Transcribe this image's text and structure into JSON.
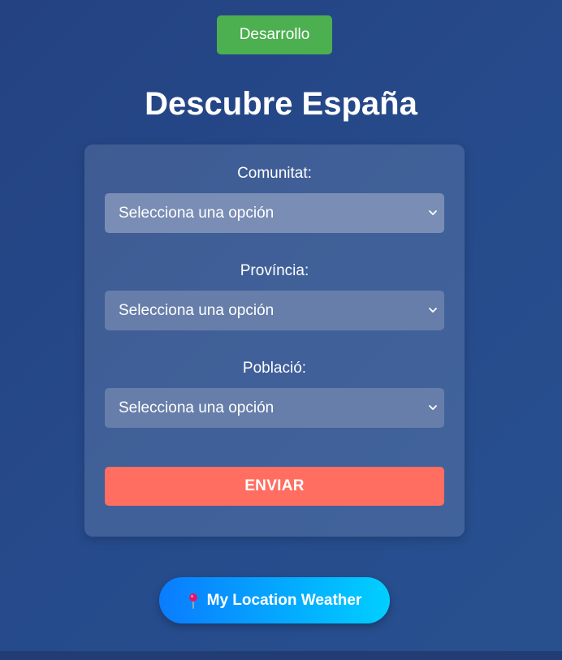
{
  "environment": {
    "label": "Desarrollo",
    "color": "#4caf50"
  },
  "page": {
    "title": "Descubre España"
  },
  "form": {
    "fields": [
      {
        "label": "Comunitat:",
        "selected": "Selecciona una opción"
      },
      {
        "label": "Província:",
        "selected": "Selecciona una opción"
      },
      {
        "label": "Població:",
        "selected": "Selecciona una opción"
      }
    ],
    "submit_label": "ENVIAR",
    "submit_color": "#ff6e61"
  },
  "weather_button": {
    "label": "My Location Weather",
    "icon": "map-pin-icon"
  },
  "colors": {
    "background": "#254686",
    "accent_gradient_start": "#0a7cff",
    "accent_gradient_end": "#00cfff"
  }
}
